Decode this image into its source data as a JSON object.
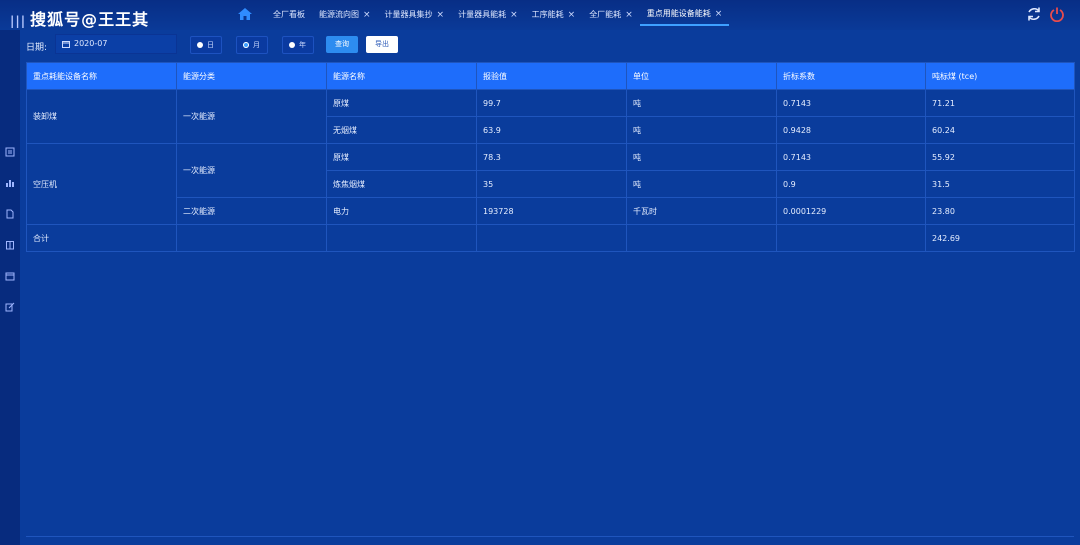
{
  "app": {
    "title": "搜狐号@王王其"
  },
  "tabs": [
    {
      "label": "全厂看板",
      "closable": false
    },
    {
      "label": "能源流向图",
      "closable": true
    },
    {
      "label": "计量器具集抄",
      "closable": true
    },
    {
      "label": "计量器具能耗",
      "closable": true
    },
    {
      "label": "工序能耗",
      "closable": true
    },
    {
      "label": "全厂能耗",
      "closable": true
    },
    {
      "label": "重点用能设备能耗",
      "closable": true,
      "active": true
    }
  ],
  "icons": {
    "close": "×",
    "refresh": "refresh-icon",
    "power": "power-icon",
    "home": "home-icon"
  },
  "toolbar": {
    "date_label": "日期:",
    "date_value": "2020-07",
    "radios": [
      {
        "label": "日",
        "checked": false
      },
      {
        "label": "月",
        "checked": true
      },
      {
        "label": "年",
        "checked": false
      }
    ],
    "query_label": "查询",
    "export_label": "导出"
  },
  "table": {
    "headers": [
      "重点耗能设备名称",
      "能源分类",
      "能源名称",
      "报验值",
      "单位",
      "折标系数",
      "吨标煤 (tce)"
    ],
    "groups": {
      "g1": {
        "device": "装卸煤",
        "category": "一次能源"
      },
      "g2": {
        "device": "空压机",
        "category1": "一次能源",
        "category2": "二次能源"
      },
      "total": {
        "label": "合计",
        "value": "242.69"
      }
    },
    "rows": [
      {
        "energy": "原煤",
        "value": "99.7",
        "unit": "吨",
        "factor": "0.7143",
        "tce": "71.21"
      },
      {
        "energy": "无烟煤",
        "value": "63.9",
        "unit": "吨",
        "factor": "0.9428",
        "tce": "60.24"
      },
      {
        "energy": "原煤",
        "value": "78.3",
        "unit": "吨",
        "factor": "0.7143",
        "tce": "55.92"
      },
      {
        "energy": "炼焦烟煤",
        "value": "35",
        "unit": "吨",
        "factor": "0.9",
        "tce": "31.5"
      },
      {
        "energy": "电力",
        "value": "193728",
        "unit": "千瓦时",
        "factor": "0.0001229",
        "tce": "23.80"
      }
    ]
  },
  "colors": {
    "background": "#0a3c9c",
    "header_row": "#1e6dfb",
    "accent": "#3ea0ff",
    "power": "#e84c4c"
  }
}
